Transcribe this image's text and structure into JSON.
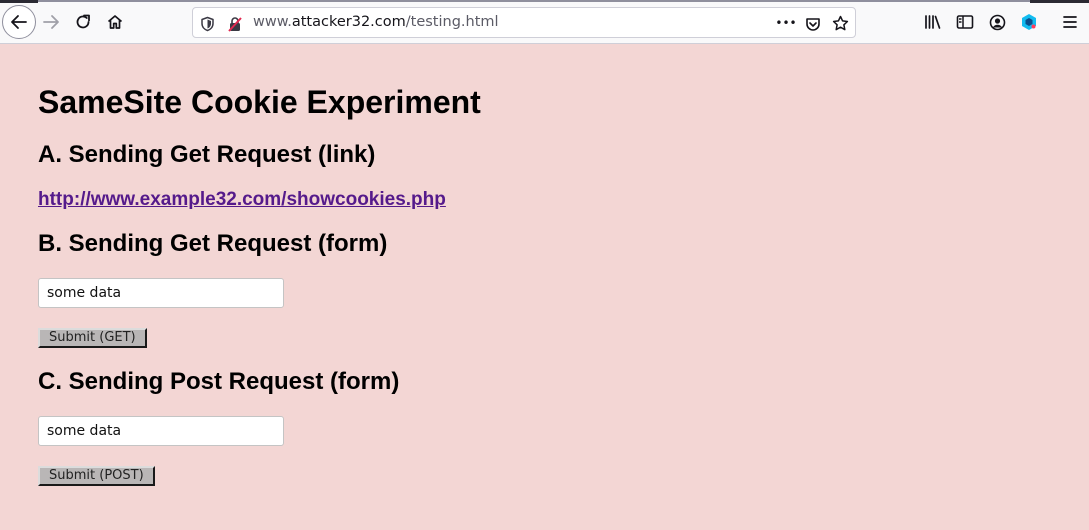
{
  "browser": {
    "url_prefix": "www.",
    "url_host": "attacker32.com",
    "url_path": "/testing.html",
    "page_actions_label": "•••"
  },
  "page": {
    "title": "SameSite Cookie Experiment",
    "section_a": {
      "heading": "A. Sending Get Request (link)",
      "link_text": "http://www.example32.com/showcookies.php"
    },
    "section_b": {
      "heading": "B. Sending Get Request (form)",
      "input_value": "some data",
      "submit_label": "Submit (GET)"
    },
    "section_c": {
      "heading": "C. Sending Post Request (form)",
      "input_value": "some data",
      "submit_label": "Submit (POST)"
    }
  },
  "colors": {
    "page_background": "#f3d6d4",
    "visited_link": "#551a8b",
    "extension_accent": "#12bcf0"
  },
  "icons": [
    "back-arrow-icon",
    "forward-arrow-icon",
    "reload-icon",
    "home-icon",
    "shield-icon",
    "insecure-lock-icon",
    "pocket-icon",
    "star-icon",
    "library-icon",
    "sidebar-icon",
    "account-icon",
    "extension-icon",
    "hamburger-menu-icon"
  ]
}
